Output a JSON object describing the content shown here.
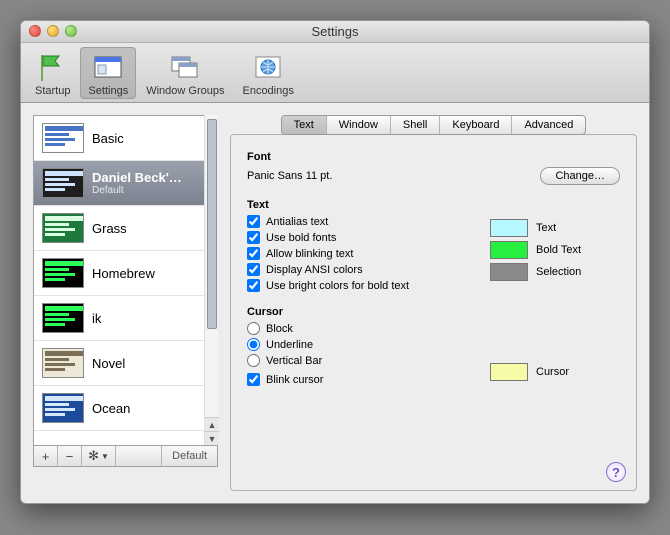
{
  "window": {
    "title": "Settings"
  },
  "toolbar": {
    "items": [
      {
        "label": "Startup"
      },
      {
        "label": "Settings",
        "selected": true
      },
      {
        "label": "Window Groups"
      },
      {
        "label": "Encodings"
      }
    ]
  },
  "profiles": [
    {
      "name": "Basic",
      "thumb_bg": "#ffffff",
      "thumb_fg": "#4a74c6"
    },
    {
      "name": "Daniel Beck'…",
      "sub": "Default",
      "selected": true,
      "thumb_bg": "#1e1e1e",
      "thumb_fg": "#cfe3ff"
    },
    {
      "name": "Grass",
      "thumb_bg": "#1e7a3a",
      "thumb_fg": "#d9ffe0"
    },
    {
      "name": "Homebrew",
      "thumb_bg": "#000000",
      "thumb_fg": "#29ff57"
    },
    {
      "name": "ik",
      "thumb_bg": "#000000",
      "thumb_fg": "#29ff57"
    },
    {
      "name": "Novel",
      "thumb_bg": "#ece7d6",
      "thumb_fg": "#7a6e55"
    },
    {
      "name": "Ocean",
      "thumb_bg": "#1d4b9c",
      "thumb_fg": "#d5e6ff"
    }
  ],
  "list_footer": {
    "add": "+",
    "remove": "−",
    "gear": "✻▾",
    "default_label": "Default"
  },
  "tabs": [
    {
      "label": "Text",
      "selected": true
    },
    {
      "label": "Window"
    },
    {
      "label": "Shell"
    },
    {
      "label": "Keyboard"
    },
    {
      "label": "Advanced"
    }
  ],
  "sections": {
    "font": {
      "heading": "Font",
      "value": "Panic Sans 11 pt.",
      "change_btn": "Change…"
    },
    "text": {
      "heading": "Text",
      "checks": [
        {
          "label": "Antialias text",
          "checked": true
        },
        {
          "label": "Use bold fonts",
          "checked": true
        },
        {
          "label": "Allow blinking text",
          "checked": true
        },
        {
          "label": "Display ANSI colors",
          "checked": true
        },
        {
          "label": "Use bright colors for bold text",
          "checked": true
        }
      ],
      "swatches": [
        {
          "label": "Text",
          "color": "#b7f7ff"
        },
        {
          "label": "Bold Text",
          "color": "#27ef3f"
        },
        {
          "label": "Selection",
          "color": "#8a8a8a"
        }
      ]
    },
    "cursor": {
      "heading": "Cursor",
      "radios": [
        {
          "label": "Block",
          "checked": false
        },
        {
          "label": "Underline",
          "checked": true
        },
        {
          "label": "Vertical Bar",
          "checked": false
        }
      ],
      "blink": {
        "label": "Blink cursor",
        "checked": true
      },
      "swatch": {
        "label": "Cursor",
        "color": "#f7fba8"
      }
    }
  }
}
